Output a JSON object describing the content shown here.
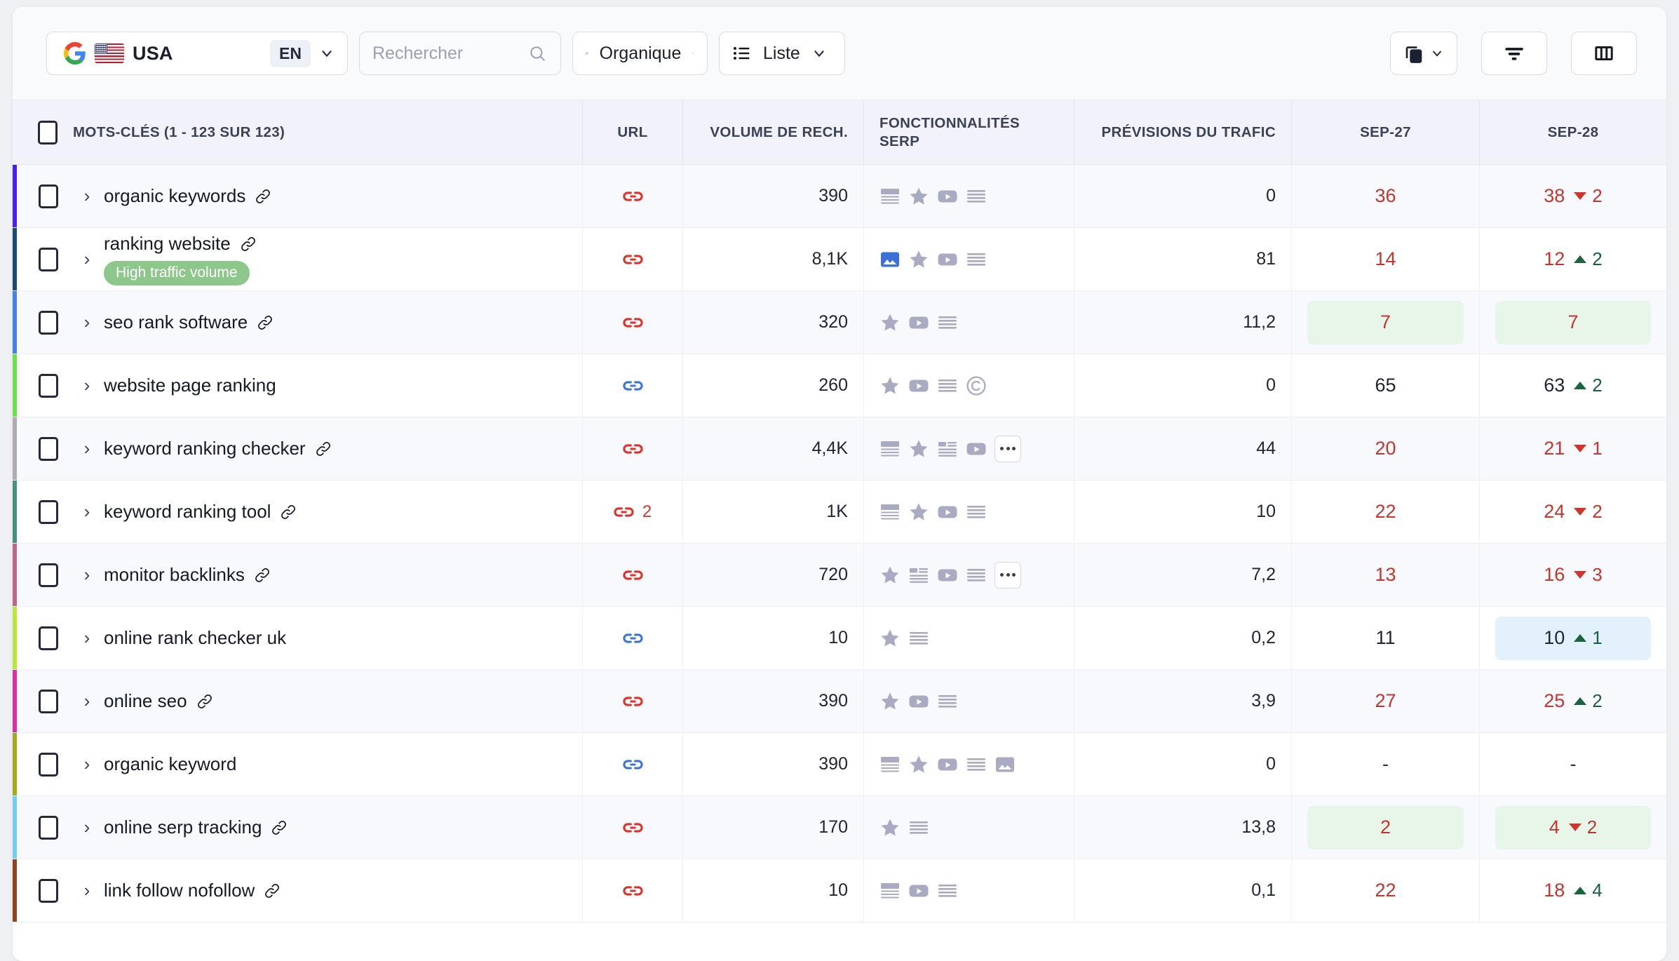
{
  "toolbar": {
    "locale": {
      "engine_icon": "google-icon",
      "flag_icon": "usa-flag-icon",
      "country": "USA",
      "language": "EN",
      "chevron": "chevron-down-icon"
    },
    "search": {
      "placeholder": "Rechercher",
      "value": "",
      "icon": "search-icon"
    },
    "view_type": {
      "label": "Organique",
      "icon": "leaf-icon",
      "chevron": "chevron-down-icon"
    },
    "display_mode": {
      "label": "Liste",
      "icon": "list-icon",
      "chevron": "chevron-down-icon"
    },
    "actions": [
      {
        "name": "copy-button",
        "icon": "copy-icon",
        "chevron": "chevron-down-icon"
      },
      {
        "name": "filter-button",
        "icon": "filter-icon"
      },
      {
        "name": "columns-button",
        "icon": "columns-icon"
      }
    ]
  },
  "table": {
    "headers": {
      "keywords": "MOTS-CLÉS (1 - 123 SUR 123)",
      "url": "URL",
      "volume": "VOLUME DE RECH.",
      "serp": "FONCTIONNALITÉS SERP",
      "traffic": "PRÉVISIONS DU TRAFIC",
      "date1": "SEP-27",
      "date2": "SEP-28"
    },
    "rows": [
      {
        "accent": "#4b1ef5",
        "keyword": "organic keywords",
        "has_link_icon": true,
        "tag": null,
        "url": {
          "color": "red",
          "count": null
        },
        "volume": "390",
        "serp": [
          "snippet",
          "star",
          "video",
          "lines"
        ],
        "traffic": "0",
        "d1": {
          "value": "36",
          "color": "red",
          "hl": null
        },
        "d2": {
          "value": "38",
          "color": "red",
          "delta": "2",
          "dir": "down",
          "hl": null
        }
      },
      {
        "accent": "#1b4a70",
        "keyword": "ranking website",
        "has_link_icon": true,
        "tag": "High traffic volume",
        "url": {
          "color": "red",
          "count": null
        },
        "volume": "8,1K",
        "serp": [
          "image-blue",
          "star",
          "video",
          "lines"
        ],
        "traffic": "81",
        "d1": {
          "value": "14",
          "color": "red",
          "hl": null
        },
        "d2": {
          "value": "12",
          "color": "red",
          "delta": "2",
          "dir": "up",
          "hl": null
        }
      },
      {
        "accent": "#4a7fe8",
        "keyword": "seo rank software",
        "has_link_icon": true,
        "tag": null,
        "url": {
          "color": "red",
          "count": null
        },
        "volume": "320",
        "serp": [
          "star",
          "video",
          "lines"
        ],
        "traffic": "11,2",
        "d1": {
          "value": "7",
          "color": "red",
          "hl": "green"
        },
        "d2": {
          "value": "7",
          "color": "red",
          "delta": null,
          "dir": null,
          "hl": "green"
        }
      },
      {
        "accent": "#6ce04a",
        "keyword": "website page ranking",
        "has_link_icon": false,
        "tag": null,
        "url": {
          "color": "blue",
          "count": null
        },
        "volume": "260",
        "serp": [
          "star",
          "video",
          "lines",
          "copyright"
        ],
        "traffic": "0",
        "d1": {
          "value": "65",
          "color": "dark",
          "hl": null
        },
        "d2": {
          "value": "63",
          "color": "dark",
          "delta": "2",
          "dir": "up",
          "hl": null
        }
      },
      {
        "accent": "#b0abae",
        "keyword": "keyword ranking checker",
        "has_link_icon": true,
        "tag": null,
        "url": {
          "color": "red",
          "count": null
        },
        "volume": "4,4K",
        "serp": [
          "snippet",
          "star",
          "table",
          "video",
          "more"
        ],
        "traffic": "44",
        "d1": {
          "value": "20",
          "color": "red",
          "hl": null
        },
        "d2": {
          "value": "21",
          "color": "red",
          "delta": "1",
          "dir": "down",
          "hl": null
        }
      },
      {
        "accent": "#46907f",
        "keyword": "keyword ranking tool",
        "has_link_icon": true,
        "tag": null,
        "url": {
          "color": "red",
          "count": "2"
        },
        "volume": "1K",
        "serp": [
          "snippet",
          "star",
          "video",
          "lines"
        ],
        "traffic": "10",
        "d1": {
          "value": "22",
          "color": "red",
          "hl": null
        },
        "d2": {
          "value": "24",
          "color": "red",
          "delta": "2",
          "dir": "down",
          "hl": null
        }
      },
      {
        "accent": "#c06489",
        "keyword": "monitor backlinks",
        "has_link_icon": true,
        "tag": null,
        "url": {
          "color": "red",
          "count": null
        },
        "volume": "720",
        "serp": [
          "star",
          "table",
          "video",
          "lines",
          "more"
        ],
        "traffic": "7,2",
        "d1": {
          "value": "13",
          "color": "red",
          "hl": null
        },
        "d2": {
          "value": "16",
          "color": "red",
          "delta": "3",
          "dir": "down",
          "hl": null
        }
      },
      {
        "accent": "#b9e83a",
        "keyword": "online rank checker uk",
        "has_link_icon": false,
        "tag": null,
        "url": {
          "color": "blue",
          "count": null
        },
        "volume": "10",
        "serp": [
          "star",
          "lines"
        ],
        "traffic": "0,2",
        "d1": {
          "value": "11",
          "color": "dark",
          "hl": null
        },
        "d2": {
          "value": "10",
          "color": "dark",
          "delta": "1",
          "dir": "up",
          "hl": "blue"
        }
      },
      {
        "accent": "#da2f9e",
        "keyword": "online seo",
        "has_link_icon": true,
        "tag": null,
        "url": {
          "color": "red",
          "count": null
        },
        "volume": "390",
        "serp": [
          "star",
          "video",
          "lines"
        ],
        "traffic": "3,9",
        "d1": {
          "value": "27",
          "color": "red",
          "hl": null
        },
        "d2": {
          "value": "25",
          "color": "red",
          "delta": "2",
          "dir": "up",
          "hl": null
        }
      },
      {
        "accent": "#a8a81e",
        "keyword": "organic keyword",
        "has_link_icon": false,
        "tag": null,
        "url": {
          "color": "blue",
          "count": null
        },
        "volume": "390",
        "serp": [
          "snippet",
          "star",
          "video",
          "lines",
          "image"
        ],
        "traffic": "0",
        "d1": {
          "value": "-",
          "color": "dark",
          "hl": null
        },
        "d2": {
          "value": "-",
          "color": "dark",
          "delta": null,
          "dir": null,
          "hl": null
        }
      },
      {
        "accent": "#74cdea",
        "keyword": "online serp tracking",
        "has_link_icon": true,
        "tag": null,
        "url": {
          "color": "red",
          "count": null
        },
        "volume": "170",
        "serp": [
          "star",
          "lines"
        ],
        "traffic": "13,8",
        "d1": {
          "value": "2",
          "color": "red",
          "hl": "green"
        },
        "d2": {
          "value": "4",
          "color": "red",
          "delta": "2",
          "dir": "down",
          "hl": "green"
        }
      },
      {
        "accent": "#8b4520",
        "keyword": "link follow nofollow",
        "has_link_icon": true,
        "tag": null,
        "url": {
          "color": "red",
          "count": null
        },
        "volume": "10",
        "serp": [
          "snippet",
          "video",
          "lines"
        ],
        "traffic": "0,1",
        "d1": {
          "value": "22",
          "color": "red",
          "hl": null
        },
        "d2": {
          "value": "18",
          "color": "red",
          "delta": "4",
          "dir": "up",
          "hl": null
        }
      }
    ]
  },
  "colors": {
    "red": "#e03127",
    "blue": "#3b74d8",
    "green_badge": "#8ec78b",
    "hl_green": "#e8f6ea",
    "hl_blue": "#e3f1fc",
    "delta_up": "#18603e",
    "delta_down": "#c8342c"
  }
}
